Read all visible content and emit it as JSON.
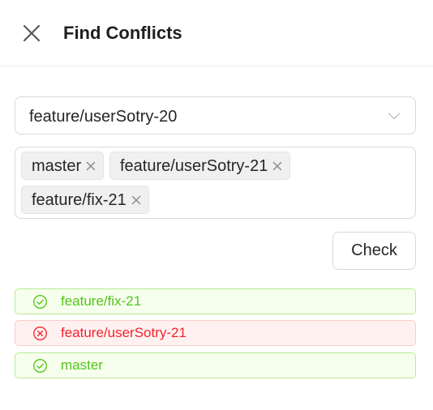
{
  "header": {
    "title": "Find Conflicts",
    "close_icon": "close-icon"
  },
  "source_branch": {
    "value": "feature/userSotry-20",
    "icon": "chevron-down-icon"
  },
  "target_branches": {
    "tags": [
      {
        "label": "master",
        "remove_icon": "close-icon"
      },
      {
        "label": "feature/userSotry-21",
        "remove_icon": "close-icon"
      },
      {
        "label": "feature/fix-21",
        "remove_icon": "close-icon"
      }
    ]
  },
  "check_button": {
    "label": "Check"
  },
  "results": [
    {
      "label": "feature/fix-21",
      "status": "success",
      "icon": "check-circle-icon",
      "color": "#52c41a"
    },
    {
      "label": "feature/userSotry-21",
      "status": "conflict",
      "icon": "close-circle-icon",
      "color": "#f5222d"
    },
    {
      "label": "master",
      "status": "success",
      "icon": "check-circle-icon",
      "color": "#52c41a"
    }
  ],
  "colors": {
    "success_bg": "#f6ffed",
    "success_border": "#b7eb8f",
    "error_bg": "#fff1f0",
    "error_border": "#ffccc7"
  }
}
